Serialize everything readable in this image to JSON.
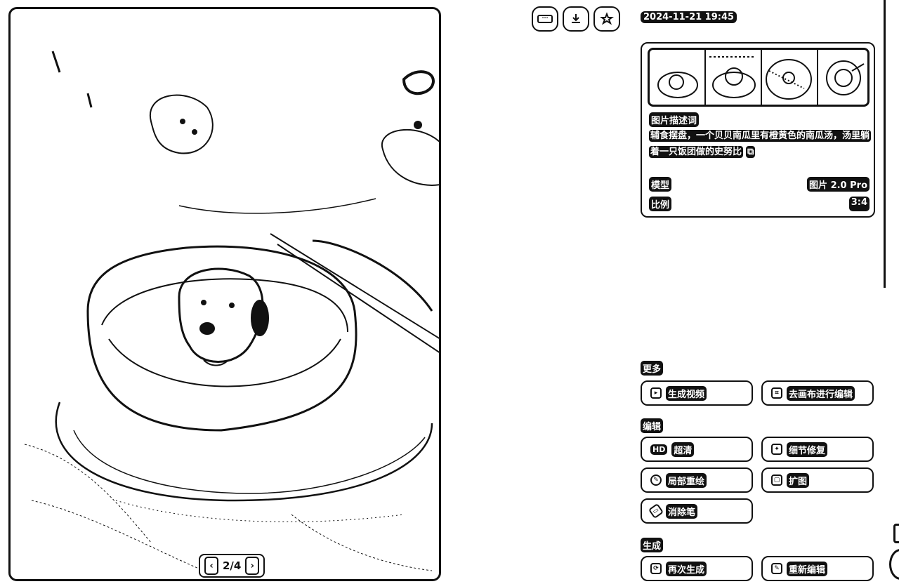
{
  "viewer": {
    "image_desc": "pumpkin soup bowl with rice ball dog",
    "pager": {
      "current": "2/4",
      "prev_icon": "chevron-left-icon",
      "next_icon": "chevron-right-icon"
    }
  },
  "toolbar": {
    "more_icon": "ellipsis-icon",
    "download_icon": "download-icon",
    "favorite_icon": "star-icon"
  },
  "meta": {
    "date": "2024-11-21 19:45"
  },
  "card": {
    "desc_title": "图片描述词",
    "desc_text": "辅食摆盘，一个贝贝南瓜里有橙黄色的南瓜汤，汤里躺着一只饭团做的史努比",
    "copy_icon": "copy-icon",
    "model_label": "模型",
    "model_value": "图片 2.0 Pro",
    "ratio_label": "比例",
    "ratio_value": "3:4"
  },
  "sections": {
    "more": {
      "title": "更多",
      "btn1": "生成视频",
      "btn2": "去画布进行编辑"
    },
    "edit": {
      "title": "编辑",
      "hd_badge": "HD",
      "btn1": "超清",
      "btn2": "细节修复",
      "btn3": "局部重绘",
      "btn4": "扩图",
      "btn5": "消除笔"
    },
    "generate": {
      "title": "生成",
      "btn1": "再次生成",
      "btn2": "重新编辑"
    }
  }
}
